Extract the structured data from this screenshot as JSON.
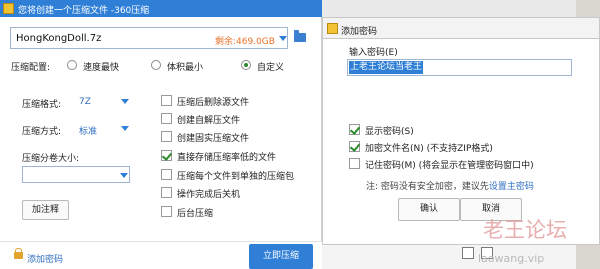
{
  "main_window": {
    "title": "您将创建一个压缩文件 -360压缩",
    "file_name": "HongKongDoll.7z",
    "space_left": "剩余:469.0GB",
    "config_label": "压缩配置:",
    "presets": [
      {
        "label": "速度最快",
        "selected": false
      },
      {
        "label": "体积最小",
        "selected": false
      },
      {
        "label": "自定义",
        "selected": true
      }
    ],
    "format_label": "压缩格式:",
    "format_value": "7Z",
    "method_label": "压缩方式:",
    "method_value": "标准",
    "split_label": "压缩分卷大小:",
    "split_value": "",
    "comment_button": "加注释",
    "options": [
      {
        "label": "压缩后删除源文件",
        "checked": false
      },
      {
        "label": "创建自解压文件",
        "checked": false
      },
      {
        "label": "创建固实压缩文件",
        "checked": false
      },
      {
        "label": "直接存储压缩率低的文件",
        "checked": true
      },
      {
        "label": "压缩每个文件到单独的压缩包",
        "checked": false
      },
      {
        "label": "操作完成后关机",
        "checked": false
      },
      {
        "label": "后台压缩",
        "checked": false
      }
    ],
    "add_password_link": "添加密码",
    "compress_button": "立即压缩"
  },
  "password_dialog": {
    "title": "添加密码",
    "input_label": "输入密码(E)",
    "password_value": "上老王论坛当老王",
    "options": [
      {
        "label": "显示密码(S)",
        "checked": true
      },
      {
        "label": "加密文件名(N) (不支持ZIP格式)",
        "checked": true
      },
      {
        "label": "记住密码(M) (将会显示在管理密码窗口中)",
        "checked": false
      }
    ],
    "note_prefix": "注: 密码没有安全加密，建议先",
    "note_link": "设置主密码",
    "ok_button": "确认",
    "cancel_button": "取消"
  },
  "watermark": {
    "text": "老王论坛",
    "url": "laowang.vip"
  },
  "colors": {
    "accent": "#2f7fd6",
    "space_left": "#e8732a",
    "check": "#2a8a2a",
    "link": "#2f6fc0"
  }
}
